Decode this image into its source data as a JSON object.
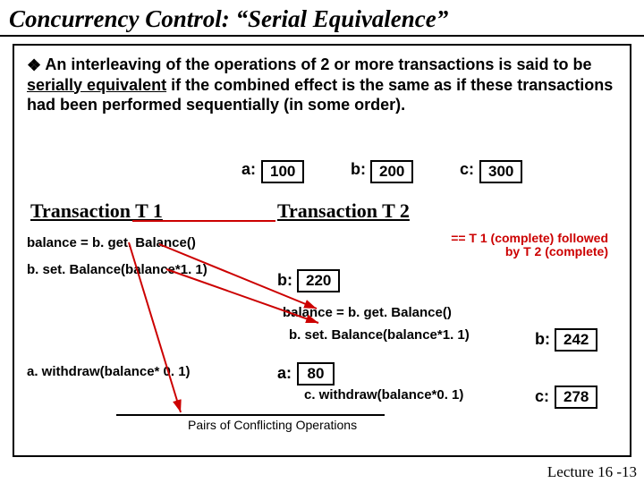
{
  "title": "Concurrency Control: “Serial Equivalence”",
  "definition_lead": "An interleaving of the operations of 2 or more transactions is said to be ",
  "definition_term": "serially equivalent",
  "definition_tail": " if the combined effect is the same as if these transactions had been performed sequentially (in some order).",
  "init": {
    "a_label": "a:",
    "a_val": "100",
    "b_label": "b:",
    "b_val": "200",
    "c_label": "c:",
    "c_val": "300"
  },
  "t1_header": "Transaction T 1",
  "t2_header": "Transaction T 2",
  "t1": {
    "line1": "balance = b. get. Balance()",
    "line2": "b. set. Balance(balance*1. 1)",
    "line3": "a. withdraw(balance* 0. 1)"
  },
  "note1": "== T 1 (complete) followed",
  "note2": "by T 2 (complete)",
  "b220_label": "b:",
  "b220_val": "220",
  "t2": {
    "line1": "balance = b. get. Balance()",
    "line2": "b. set. Balance(balance*1. 1)",
    "line3": "c. withdraw(balance*0. 1)"
  },
  "a80_label": "a:",
  "a80_val": "80",
  "b242_label": "b:",
  "b242_val": "242",
  "c278_label": "c:",
  "c278_val": "278",
  "pairs_caption": "Pairs of Conflicting Operations",
  "lecture": "Lecture 16 -13"
}
